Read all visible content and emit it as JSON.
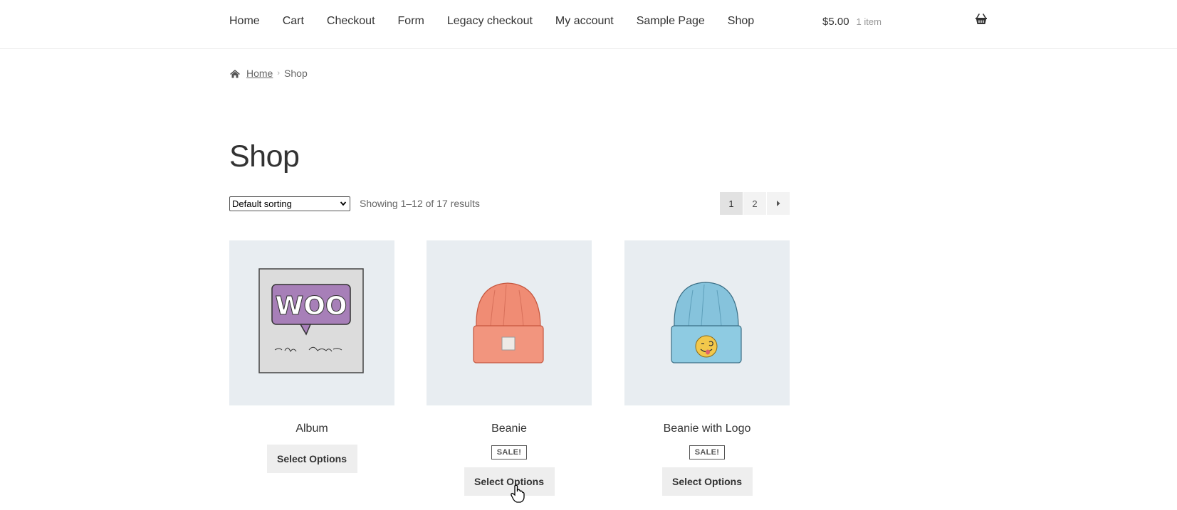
{
  "nav": {
    "items": [
      "Home",
      "Cart",
      "Checkout",
      "Form",
      "Legacy checkout",
      "My account",
      "Sample Page",
      "Shop"
    ]
  },
  "cart": {
    "amount": "$5.00",
    "count": "1 item",
    "icon": "basket-icon"
  },
  "breadcrumb": {
    "home_label": "Home",
    "current": "Shop",
    "icon": "home-icon"
  },
  "page": {
    "title": "Shop"
  },
  "toolbar": {
    "sort_selected": "Default sorting",
    "result_count": "Showing 1–12 of 17 results"
  },
  "pagination": {
    "pages": [
      "1",
      "2"
    ],
    "current": "1",
    "next_icon": "caret-right-icon"
  },
  "products": [
    {
      "name": "Album",
      "sale_label": "",
      "button_label": "Select Options",
      "image": "woo-album-image"
    },
    {
      "name": "Beanie",
      "sale_label": "SALE!",
      "button_label": "Select Options",
      "image": "orange-beanie-image"
    },
    {
      "name": "Beanie with Logo",
      "sale_label": "SALE!",
      "button_label": "Select Options",
      "image": "blue-beanie-logo-image"
    }
  ],
  "colors": {
    "thumb_bg": "#e8edf1",
    "button_bg": "#eeeeee",
    "beanie_orange": "#f08c74",
    "beanie_blue": "#86c3dc",
    "woo_purple": "#a77fb8"
  }
}
